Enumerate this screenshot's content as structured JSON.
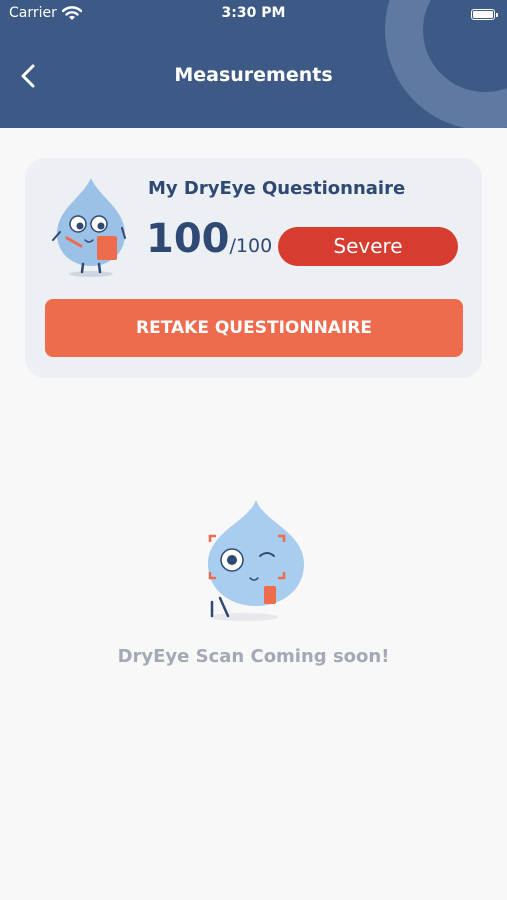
{
  "status_bar": {
    "carrier": "Carrier",
    "time": "3:30 PM"
  },
  "header": {
    "title": "Measurements"
  },
  "questionnaire": {
    "title": "My DryEye Questionnaire",
    "score": "100",
    "score_max": "/100",
    "severity": "Severe",
    "retake_label": "RETAKE QUESTIONNAIRE"
  },
  "scan": {
    "message": "DryEye Scan Coming soon!"
  },
  "colors": {
    "header": "#3d5a86",
    "accent": "#ee6b4e",
    "severe": "#d83b2f",
    "title_text": "#2f4874"
  },
  "icons": [
    "wifi-icon",
    "battery-icon",
    "back-arrow-icon",
    "questionnaire-mascot",
    "scan-mascot"
  ]
}
